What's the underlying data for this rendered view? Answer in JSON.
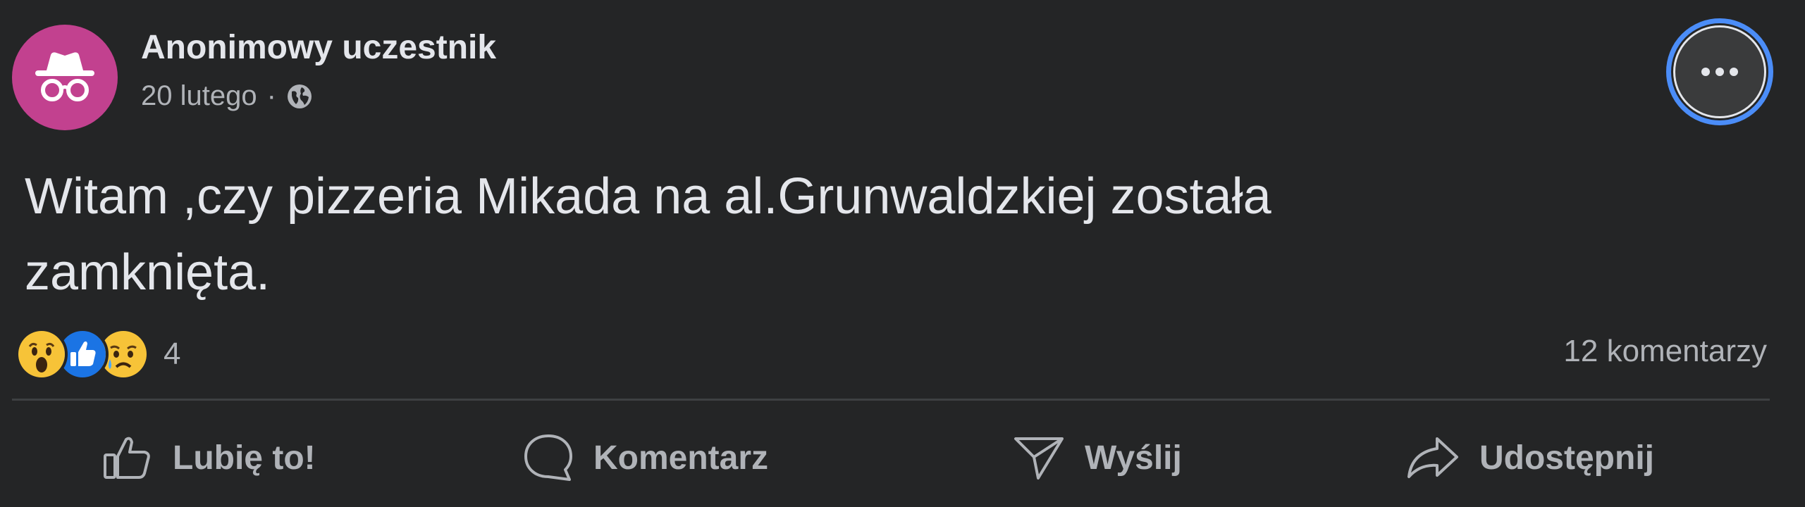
{
  "post": {
    "author": "Anonimowy uczestnik",
    "date": "20 lutego",
    "separator": "·",
    "privacy_icon": "globe-icon",
    "body_line1": "Witam ,czy pizzeria Mikada na al.Grunwaldzkiej została",
    "body_line2": "zamknięta.",
    "reactions": {
      "icons": [
        "wow-reaction-icon",
        "like-reaction-icon",
        "sad-reaction-icon"
      ],
      "count": "4"
    },
    "comments_count": "12 komentarzy"
  },
  "actions": {
    "like_label": "Lubię to!",
    "comment_label": "Komentarz",
    "send_label": "Wyślij",
    "share_label": "Udostępnij"
  },
  "colors": {
    "background": "#242526",
    "avatar": "#c2418f",
    "text_primary": "#e4e6eb",
    "text_secondary": "#b0b3b8",
    "focus_ring": "#4b8df8",
    "like_blue": "#1b74e4",
    "emoji_yellow": "#f7c338"
  }
}
